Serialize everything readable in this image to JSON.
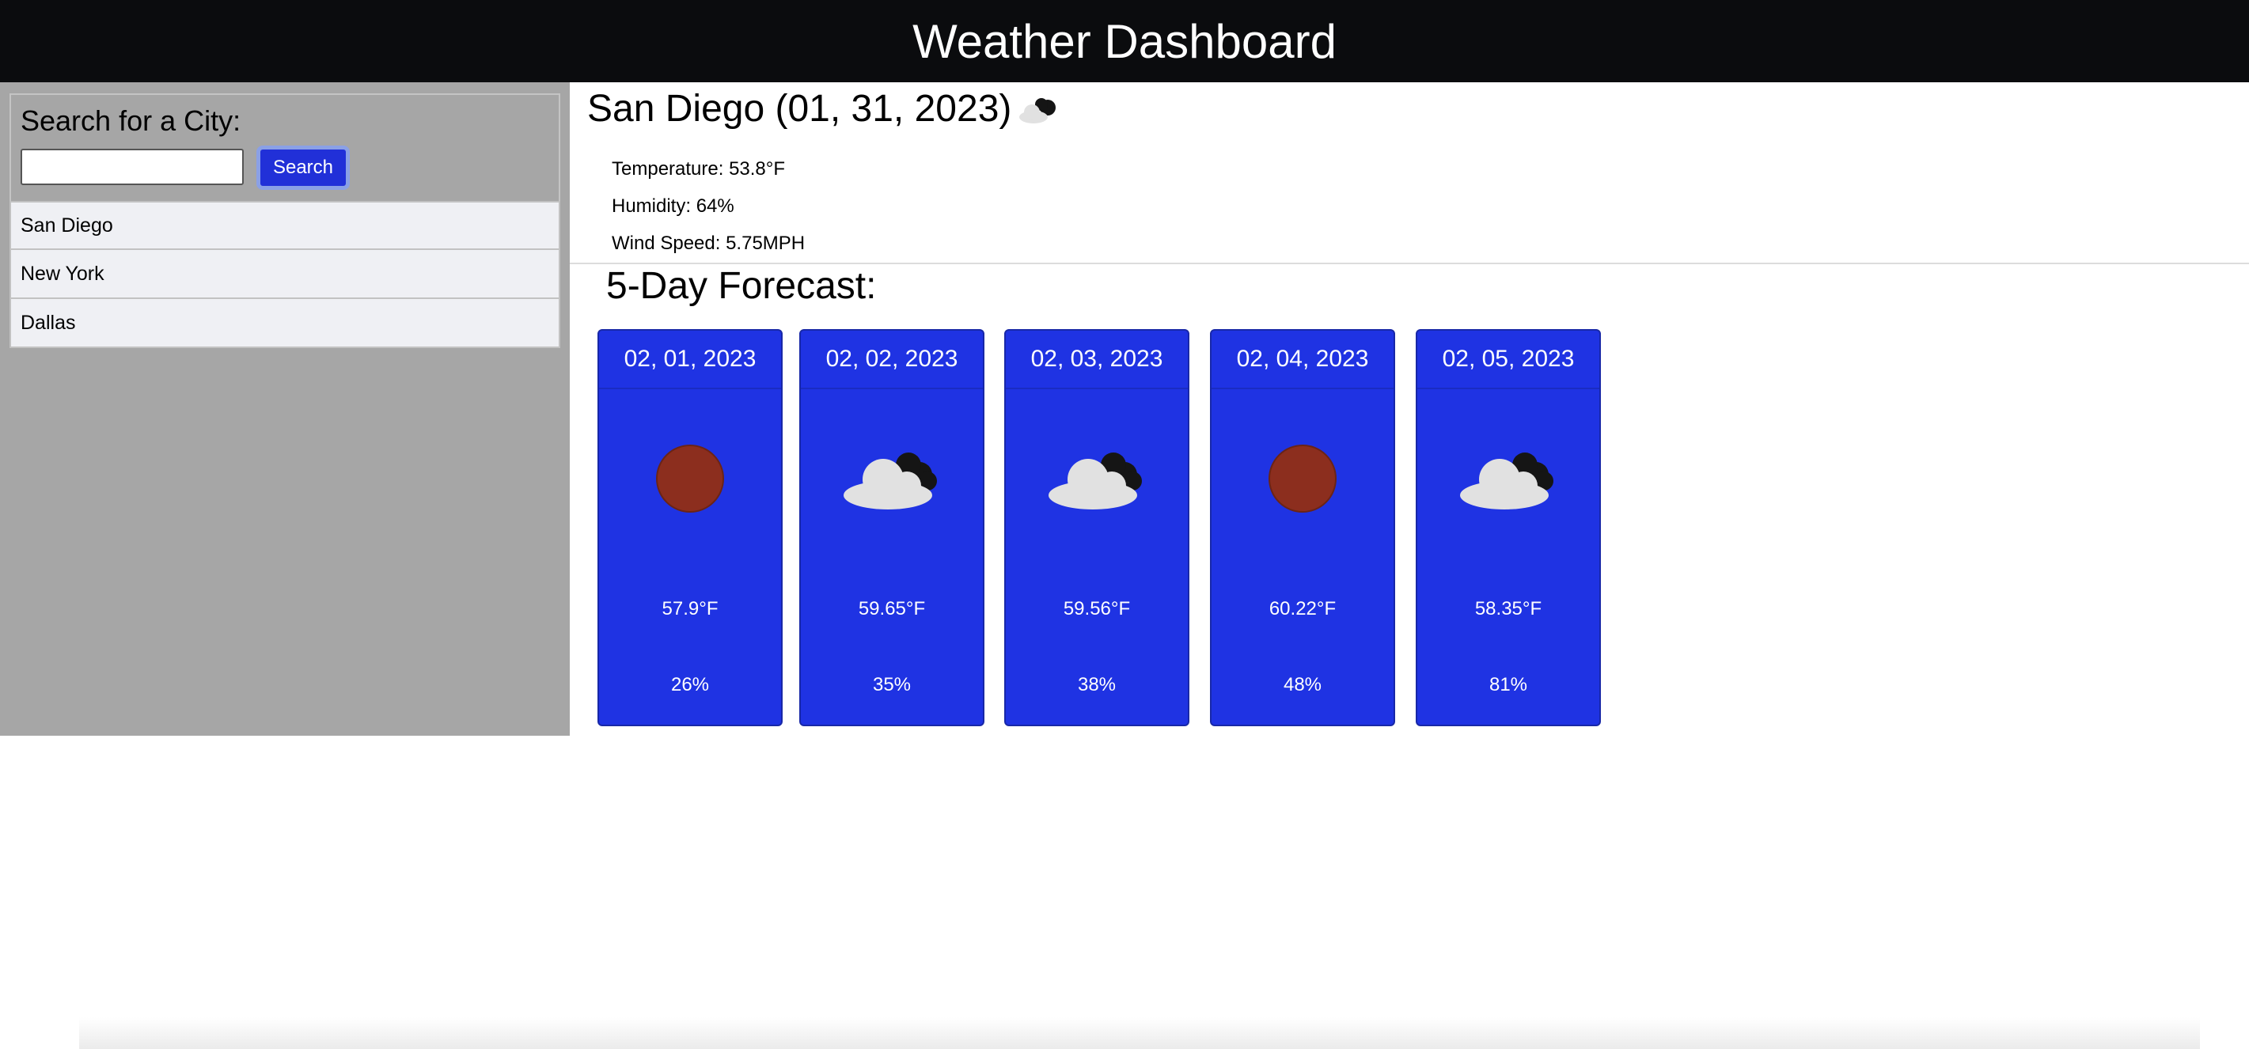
{
  "header": {
    "title": "Weather Dashboard"
  },
  "sidebar": {
    "search_title": "Search for a City:",
    "search_value": "",
    "search_placeholder": "",
    "search_button": "Search",
    "history": [
      "San Diego",
      "New York",
      "Dallas"
    ]
  },
  "current": {
    "title": "San Diego (01, 31, 2023)",
    "icon": "partly-cloudy-icon",
    "temperature": "Temperature: 53.8°F",
    "humidity": "Humidity: 64%",
    "wind": "Wind Speed: 5.75MPH"
  },
  "forecast": {
    "title": "5-Day Forecast:",
    "days": [
      {
        "date": "02, 01, 2023",
        "icon": "sun-icon",
        "temp": "57.9°F",
        "humidity": "26%"
      },
      {
        "date": "02, 02, 2023",
        "icon": "cloud-icon",
        "temp": "59.65°F",
        "humidity": "35%"
      },
      {
        "date": "02, 03, 2023",
        "icon": "cloud-icon",
        "temp": "59.56°F",
        "humidity": "38%"
      },
      {
        "date": "02, 04, 2023",
        "icon": "sun-icon",
        "temp": "60.22°F",
        "humidity": "48%"
      },
      {
        "date": "02, 05, 2023",
        "icon": "cloud-icon",
        "temp": "58.35°F",
        "humidity": "81%"
      }
    ]
  },
  "colors": {
    "header_bg": "#0b0c0e",
    "sidebar_bg": "#a6a6a6",
    "card_bg": "#1f33e3",
    "sun": "#8c2e1e",
    "cloud_light": "#e1e1e1",
    "cloud_dark": "#151515"
  }
}
